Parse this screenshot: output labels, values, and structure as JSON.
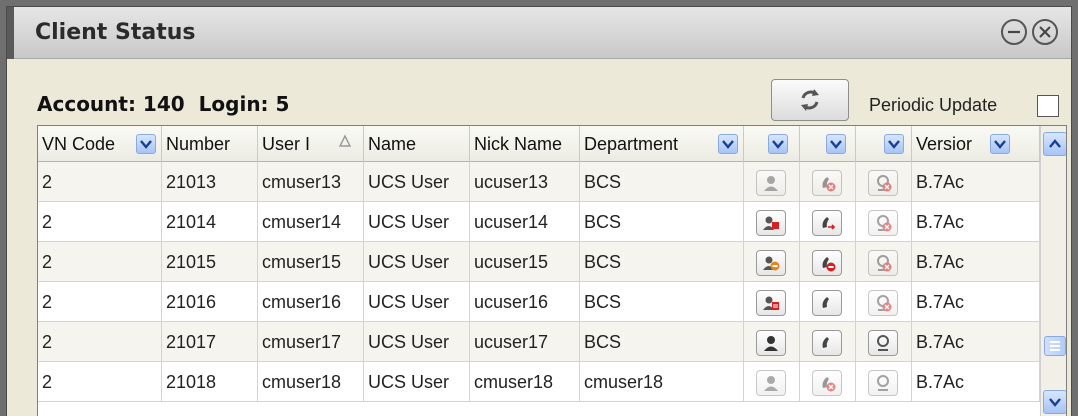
{
  "window": {
    "title": "Client Status"
  },
  "summary": {
    "account_label": "Account: 140",
    "login_label": "Login: 5"
  },
  "controls": {
    "periodic_update_label": "Periodic Update",
    "periodic_update_checked": false,
    "refresh_icon": "refresh-icon"
  },
  "table": {
    "headers": {
      "vn_code": "VN Code",
      "number": "Number",
      "user_id": "User I",
      "name": "Name",
      "nick_name": "Nick Name",
      "department": "Department",
      "version": "Versior"
    },
    "sorted_column": "user_id",
    "rows": [
      {
        "vn_code": "2",
        "number": "21013",
        "user_id": "cmuser13",
        "name": "UCS User",
        "nick_name": "ucuser13",
        "department": "BCS",
        "presence": "offline-presence-icon",
        "phone": "phone-blocked-icon",
        "login": "login-blocked-icon",
        "version": "B.7Ac",
        "presence_dim": true,
        "phone_dim": true,
        "login_dim": true
      },
      {
        "vn_code": "2",
        "number": "21014",
        "user_id": "cmuser14",
        "name": "UCS User",
        "nick_name": "ucuser14",
        "department": "BCS",
        "presence": "busy-presence-icon",
        "phone": "phone-forward-icon",
        "login": "login-blocked-icon",
        "version": "B.7Ac",
        "presence_dim": false,
        "phone_dim": false,
        "login_dim": true
      },
      {
        "vn_code": "2",
        "number": "21015",
        "user_id": "cmuser15",
        "name": "UCS User",
        "nick_name": "ucuser15",
        "department": "BCS",
        "presence": "away-presence-icon",
        "phone": "phone-dnd-icon",
        "login": "login-blocked-icon",
        "version": "B.7Ac",
        "presence_dim": false,
        "phone_dim": false,
        "login_dim": true
      },
      {
        "vn_code": "2",
        "number": "21016",
        "user_id": "cmuser16",
        "name": "UCS User",
        "nick_name": "ucuser16",
        "department": "BCS",
        "presence": "meeting-presence-icon",
        "phone": "phone-icon",
        "login": "login-blocked-icon",
        "version": "B.7Ac",
        "presence_dim": false,
        "phone_dim": false,
        "login_dim": true
      },
      {
        "vn_code": "2",
        "number": "21017",
        "user_id": "cmuser17",
        "name": "UCS User",
        "nick_name": "ucuser17",
        "department": "BCS",
        "presence": "online-presence-icon",
        "phone": "phone-icon",
        "login": "login-icon",
        "version": "B.7Ac",
        "presence_dim": false,
        "phone_dim": false,
        "login_dim": false
      },
      {
        "vn_code": "2",
        "number": "21018",
        "user_id": "cmuser18",
        "name": "UCS User",
        "nick_name": "cmuser18",
        "department": "cmuser18",
        "presence": "offline-presence-icon",
        "phone": "phone-blocked-icon",
        "login": "login-icon",
        "version": "B.7Ac",
        "presence_dim": true,
        "phone_dim": true,
        "login_dim": true
      }
    ]
  },
  "colors": {
    "title_bar": "#d6d6d6",
    "busy_red": "#d42020",
    "away_orange": "#e8861a",
    "dropdown_blue": "#a6c4f5"
  }
}
